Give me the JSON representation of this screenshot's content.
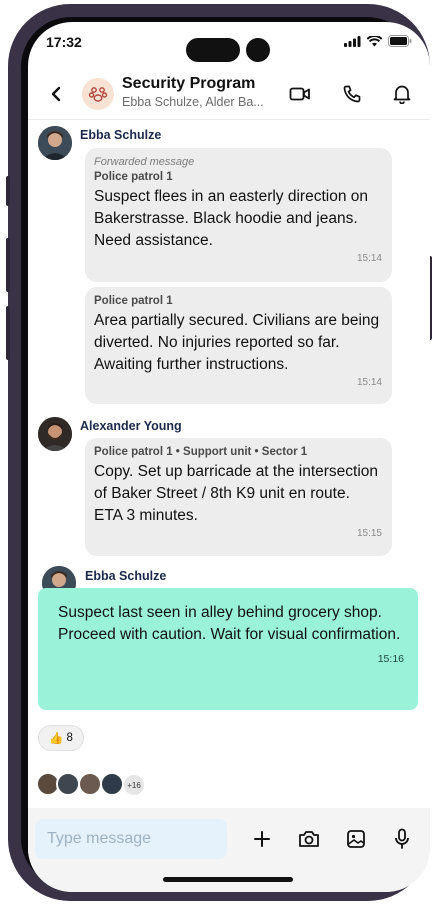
{
  "status_bar": {
    "time": "17:32"
  },
  "header": {
    "back_icon": "chevron-left-icon",
    "title": "Security Program",
    "subtitle": "Ebba Schulze, Alder Ba..."
  },
  "messages": [
    {
      "sender": "Ebba Schulze",
      "bubbles": [
        {
          "forwarded": "Forwarded message",
          "source": "Police patrol 1",
          "text": "Suspect flees in an easterly direction on Bakerstrasse. Black hoodie and jeans. Need assistance.",
          "time": "15:14"
        },
        {
          "source": "Police patrol 1",
          "text": "Area partially secured. Civilians are being diverted. No injuries reported so far. Awaiting further instructions.",
          "time": "15:14"
        }
      ]
    },
    {
      "sender": "Alexander Young",
      "bubbles": [
        {
          "source": "Police patrol 1 • Support unit • Sector 1",
          "text": "Copy. Set up barricade at the intersection of Baker Street / 8th K9 unit en route. ETA 3 minutes.",
          "time": "15:15"
        }
      ]
    },
    {
      "sender": "Ebba Schulze",
      "bubbles": [
        {
          "text": "Suspect last seen in alley behind grocery shop. Proceed with caution. Wait for visual confirmation.",
          "time": "15:16"
        }
      ]
    }
  ],
  "reaction": {
    "emoji": "👍",
    "count": "8"
  },
  "readers": {
    "more": "+16"
  },
  "composer": {
    "placeholder": "Type message"
  },
  "colors": {
    "highlight_bubble": "#9af2d9",
    "bubble": "#ededed",
    "input": "#e5f2fb"
  }
}
